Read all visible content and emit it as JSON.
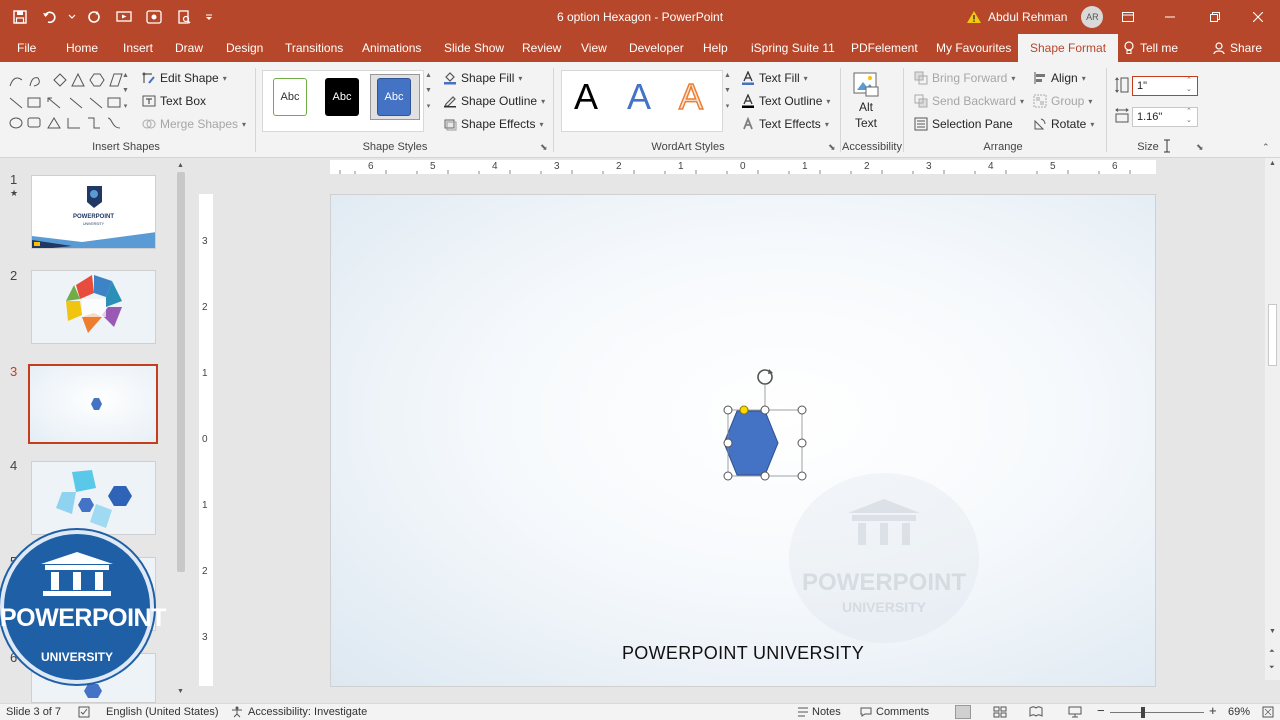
{
  "window": {
    "title": "6 option Hexagon  -  PowerPoint",
    "user_name": "Abdul Rehman",
    "user_initials": "AR"
  },
  "tabs": [
    "File",
    "Home",
    "Insert",
    "Draw",
    "Design",
    "Transitions",
    "Animations",
    "Slide Show",
    "Review",
    "View",
    "Developer",
    "Help",
    "iSpring Suite 11",
    "PDFelement",
    "My Favourites",
    "Shape Format",
    "Tell me",
    "Share"
  ],
  "ribbon": {
    "insert_shapes": {
      "label": "Insert Shapes",
      "edit_shape": "Edit Shape",
      "text_box": "Text Box",
      "merge_shapes": "Merge Shapes"
    },
    "shape_styles": {
      "label": "Shape Styles",
      "thumb_text": "Abc",
      "shape_fill": "Shape Fill",
      "shape_outline": "Shape Outline",
      "shape_effects": "Shape Effects"
    },
    "wordart": {
      "label": "WordArt Styles",
      "letter": "A",
      "text_fill": "Text Fill",
      "text_outline": "Text Outline",
      "text_effects": "Text Effects"
    },
    "accessibility": {
      "label": "Accessibility",
      "alt_text_1": "Alt",
      "alt_text_2": "Text"
    },
    "arrange": {
      "label": "Arrange",
      "bring_forward": "Bring Forward",
      "send_backward": "Send Backward",
      "selection_pane": "Selection Pane",
      "align": "Align",
      "group": "Group",
      "rotate": "Rotate"
    },
    "size": {
      "label": "Size",
      "height": "1\"",
      "width": "1.16\""
    }
  },
  "ruler": {
    "h_ticks": [
      "6",
      "5",
      "4",
      "3",
      "2",
      "1",
      "0",
      "1",
      "2",
      "3",
      "4",
      "5",
      "6"
    ],
    "v_ticks": [
      "3",
      "2",
      "1",
      "0",
      "1",
      "2",
      "3"
    ]
  },
  "thumbnails": {
    "numbers": [
      "1",
      "2",
      "3",
      "4",
      "5",
      "6"
    ],
    "star": "★",
    "selected": 3,
    "logo_title": "POWERPOINT",
    "logo_sub": "UNIVERSITY"
  },
  "slide": {
    "footer_text": "POWERPOINT UNIVERSITY",
    "watermark_title": "POWERPOINT",
    "watermark_sub": "UNIVERSITY",
    "hexagon_color": "#4472c4"
  },
  "overlay_logo": {
    "title": "POWERPOINT",
    "subtitle": "UNIVERSITY"
  },
  "status": {
    "slide_info": "Slide 3 of 7",
    "language": "English (United States)",
    "accessibility": "Accessibility: Investigate",
    "notes": "Notes",
    "comments": "Comments",
    "zoom": "69%"
  },
  "colors": {
    "accent": "#b7472a",
    "selection": "#c43e1c"
  }
}
